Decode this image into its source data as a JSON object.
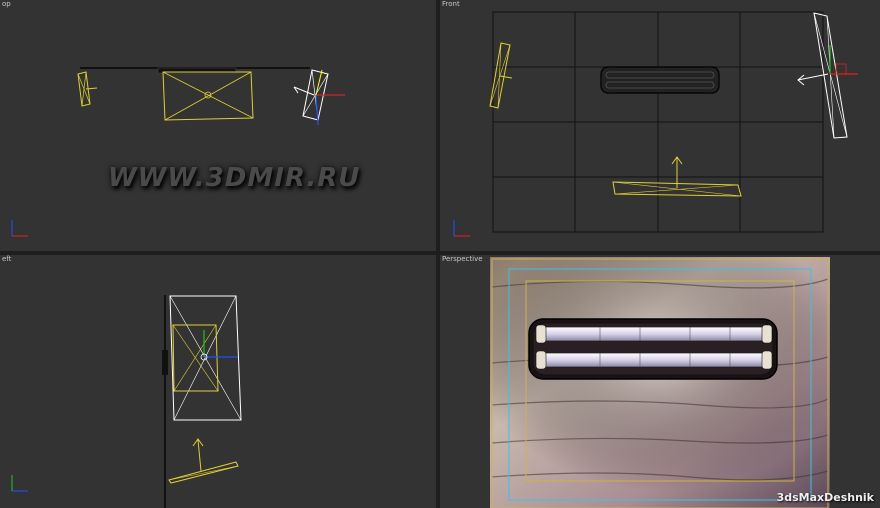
{
  "viewports": {
    "top": {
      "label": "op"
    },
    "front": {
      "label": "Front"
    },
    "left": {
      "label": "eft"
    },
    "perspective": {
      "label": "Perspective"
    }
  },
  "watermark": "WWW.3DMIR.RU",
  "brand": "3dsMaxDeshnik",
  "colors": {
    "viewport_bg": "#333333",
    "light_object": "#e0d030",
    "selected_object": "#ffffff",
    "axis_x": "#e02020",
    "axis_y": "#20c020",
    "axis_z": "#2050ff",
    "safe_frame": "#d0b050",
    "action_safe": "#40c0e0"
  }
}
